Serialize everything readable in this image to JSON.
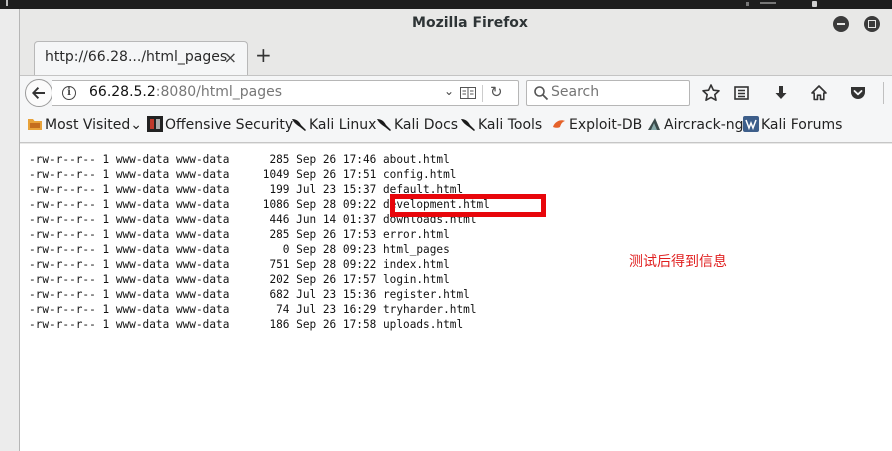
{
  "window": {
    "title": "Mozilla Firefox"
  },
  "tab": {
    "label": "http://66.28.../html_pages",
    "close": "×",
    "new_tab": "+"
  },
  "urlbar": {
    "host": "66.28.5.2",
    "rest": ":8080/html_pages",
    "dropdown": "⌄"
  },
  "search": {
    "placeholder": "Search"
  },
  "bookmarks": {
    "most_visited": "Most Visited",
    "items": [
      "Offensive Security",
      "Kali Linux",
      "Kali Docs",
      "Kali Tools",
      "Exploit-DB",
      "Aircrack-ng",
      "Kali Forums"
    ]
  },
  "listing": [
    "-rw-r--r-- 1 www-data www-data      285 Sep 26 17:46 about.html",
    "-rw-r--r-- 1 www-data www-data     1049 Sep 26 17:51 config.html",
    "-rw-r--r-- 1 www-data www-data      199 Jul 23 15:37 default.html",
    "-rw-r--r-- 1 www-data www-data     1086 Sep 28 09:22 development.html",
    "-rw-r--r-- 1 www-data www-data      446 Jun 14 01:37 downloads.html",
    "-rw-r--r-- 1 www-data www-data      285 Sep 26 17:53 error.html",
    "-rw-r--r-- 1 www-data www-data        0 Sep 28 09:23 html_pages",
    "-rw-r--r-- 1 www-data www-data      751 Sep 28 09:22 index.html",
    "-rw-r--r-- 1 www-data www-data      202 Sep 26 17:57 login.html",
    "-rw-r--r-- 1 www-data www-data      682 Jul 23 15:36 register.html",
    "-rw-r--r-- 1 www-data www-data       74 Jul 23 16:29 tryharder.html",
    "-rw-r--r-- 1 www-data www-data      186 Sep 26 17:58 uploads.html"
  ],
  "annotation": "测试后得到信息",
  "colors": {
    "highlight": "#e8060b",
    "annotation": "#e01e1e"
  }
}
